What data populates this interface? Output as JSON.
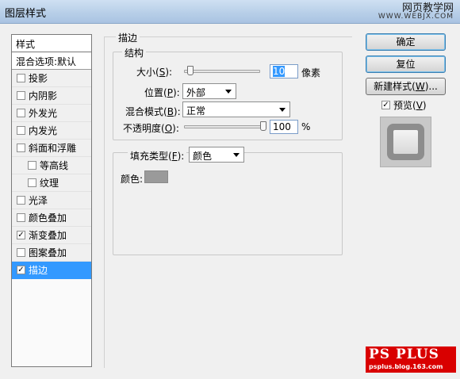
{
  "window": {
    "title": "图层样式"
  },
  "watermark": {
    "line1": "网页教学网",
    "line2": "WWW.WEBJX.COM"
  },
  "styles_panel": {
    "header": "样式",
    "blend_options": "混合选项:默认",
    "items": [
      {
        "label": "投影",
        "checked": false
      },
      {
        "label": "内阴影",
        "checked": false
      },
      {
        "label": "外发光",
        "checked": false
      },
      {
        "label": "内发光",
        "checked": false
      },
      {
        "label": "斜面和浮雕",
        "checked": false
      },
      {
        "label": "等高线",
        "checked": false
      },
      {
        "label": "纹理",
        "checked": false
      },
      {
        "label": "光泽",
        "checked": false
      },
      {
        "label": "颜色叠加",
        "checked": false
      },
      {
        "label": "渐变叠加",
        "checked": true
      },
      {
        "label": "图案叠加",
        "checked": false
      },
      {
        "label": "描边",
        "checked": true
      }
    ]
  },
  "stroke": {
    "group_title": "描边",
    "structure_title": "结构",
    "size_label": "大小(",
    "size_key": "S",
    "size_label_end": "):",
    "size_value": "10",
    "size_unit": "像素",
    "position_label": "位置(",
    "position_key": "P",
    "position_label_end": "):",
    "position_value": "外部",
    "blend_label": "混合模式(",
    "blend_key": "B",
    "blend_label_end": "):",
    "blend_value": "正常",
    "opacity_label": "不透明度(",
    "opacity_key": "O",
    "opacity_label_end": "):",
    "opacity_value": "100",
    "opacity_unit": "%",
    "fill_type_label": "填充类型(",
    "fill_type_key": "F",
    "fill_type_label_end": "):",
    "fill_type_value": "颜色",
    "color_label": "颜色:",
    "color_swatch": "#9a9a9a",
    "size_slider_fraction": 0.04,
    "opacity_slider_fraction": 1.0
  },
  "buttons": {
    "ok": "确定",
    "reset": "复位",
    "new_style_prefix": "新建样式(",
    "new_style_key": "W",
    "new_style_suffix": ")...",
    "preview_prefix": "预览(",
    "preview_key": "V",
    "preview_suffix": ")",
    "preview_checked": true
  },
  "logo": {
    "main": "PS PLUS",
    "sub": "psplus.blog.163.com"
  }
}
